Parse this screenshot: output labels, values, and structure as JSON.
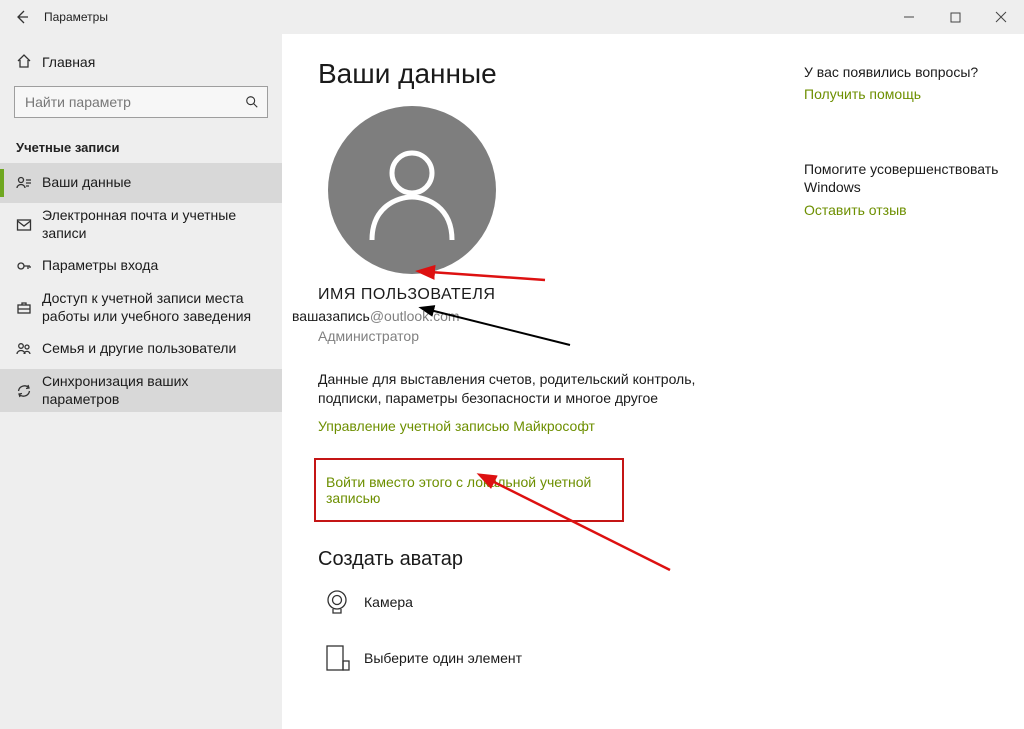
{
  "window": {
    "title": "Параметры"
  },
  "sidebar": {
    "home": "Главная",
    "search_placeholder": "Найти параметр",
    "group": "Учетные записи",
    "items": [
      {
        "label": "Ваши данные"
      },
      {
        "label": "Электронная почта и учетные записи"
      },
      {
        "label": "Параметры входа"
      },
      {
        "label": "Доступ к учетной записи места работы или учебного заведения"
      },
      {
        "label": "Семья и другие пользователи"
      },
      {
        "label": "Синхронизация ваших параметров"
      }
    ]
  },
  "main": {
    "page_title": "Ваши данные",
    "username": "ИМЯ ПОЛЬЗОВАТЕЛЯ",
    "email_user": "вашазапись",
    "email_suffix": "@outlook.com",
    "role": "Администратор",
    "desc": "Данные для выставления счетов, родительский контроль, подписки, параметры безопасности и многое другое",
    "manage_link": "Управление учетной записью Майкрософт",
    "local_link": "Войти вместо этого с локальной учетной записью",
    "avatar_title": "Создать аватар",
    "option_camera": "Камера",
    "option_browse": "Выберите один элемент"
  },
  "help": {
    "q1": "У вас появились вопросы?",
    "a1": "Получить помощь",
    "q2": "Помогите усовершенствовать Windows",
    "a2": "Оставить отзыв"
  }
}
